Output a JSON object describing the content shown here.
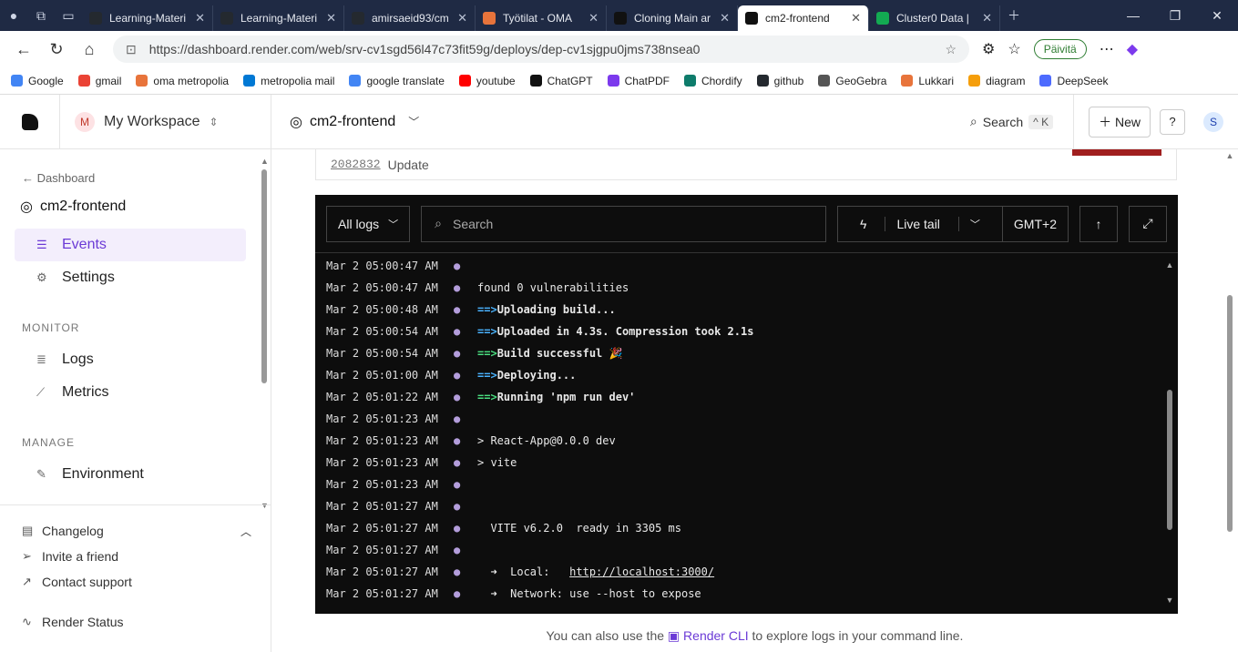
{
  "browser": {
    "tabs": [
      {
        "label": "Learning-Materi",
        "color": "#24292f"
      },
      {
        "label": "Learning-Materi",
        "color": "#24292f"
      },
      {
        "label": "amirsaeid93/cm",
        "color": "#24292f"
      },
      {
        "label": "Työtilat - OMA",
        "color": "#e8743b"
      },
      {
        "label": "Cloning Main ar",
        "color": "#111111"
      },
      {
        "label": "cm2-frontend",
        "color": "#111111",
        "active": true
      },
      {
        "label": "Cluster0 Data |",
        "color": "#13aa52"
      }
    ],
    "url": "https://dashboard.render.com/web/srv-cv1sgd56l47c73fit59g/deploys/dep-cv1sjgpu0jms738nsea0",
    "update_label": "Päivitä",
    "bookmarks": [
      {
        "label": "Google",
        "color": "#4285f4"
      },
      {
        "label": "gmail",
        "color": "#ea4335"
      },
      {
        "label": "oma metropolia",
        "color": "#e8743b"
      },
      {
        "label": "metropolia mail",
        "color": "#0078d4"
      },
      {
        "label": "google translate",
        "color": "#4285f4"
      },
      {
        "label": "youtube",
        "color": "#ff0000"
      },
      {
        "label": "ChatGPT",
        "color": "#111111"
      },
      {
        "label": "ChatPDF",
        "color": "#7c3aed"
      },
      {
        "label": "Chordify",
        "color": "#0e7c6b"
      },
      {
        "label": "github",
        "color": "#24292f"
      },
      {
        "label": "GeoGebra",
        "color": "#555555"
      },
      {
        "label": "Lukkari",
        "color": "#e8743b"
      },
      {
        "label": "diagram",
        "color": "#f59e0b"
      },
      {
        "label": "DeepSeek",
        "color": "#4d6bfe"
      }
    ]
  },
  "sidebar": {
    "workspace_initial": "M",
    "workspace": "My Workspace",
    "back_label": "Dashboard",
    "service": "cm2-frontend",
    "items": [
      {
        "label": "Events",
        "icon": "list-icon"
      },
      {
        "label": "Settings",
        "icon": "gear-icon"
      }
    ],
    "monitor_title": "MONITOR",
    "monitor_items": [
      {
        "label": "Logs",
        "icon": "logs-icon"
      },
      {
        "label": "Metrics",
        "icon": "chart-icon"
      }
    ],
    "manage_title": "MANAGE",
    "manage_items": [
      {
        "label": "Environment",
        "icon": "edit-icon"
      }
    ],
    "bottom": {
      "changelog": "Changelog",
      "invite": "Invite a friend",
      "support": "Contact support",
      "status": "Render Status"
    }
  },
  "topbar": {
    "service": "cm2-frontend",
    "search": "Search",
    "shortcut": "^ K",
    "new_label": "New",
    "user_initial": "S"
  },
  "deploy_card": {
    "commit": "2082832",
    "message": "Update"
  },
  "logs": {
    "filter": "All logs",
    "search_placeholder": "Search",
    "live_tail": "Live tail",
    "timezone": "GMT+2",
    "lines": [
      {
        "ts": "Mar 2 05:00:47 AM",
        "msg": ""
      },
      {
        "ts": "Mar 2 05:00:47 AM",
        "msg": "found 0 vulnerabilities"
      },
      {
        "ts": "Mar 2 05:00:48 AM",
        "arrow": "==>",
        "arrow_color": "blue",
        "msg": "Uploading build..."
      },
      {
        "ts": "Mar 2 05:00:54 AM",
        "arrow": "==>",
        "arrow_color": "blue",
        "msg": "Uploaded in 4.3s. Compression took 2.1s"
      },
      {
        "ts": "Mar 2 05:00:54 AM",
        "arrow": "==>",
        "arrow_color": "green",
        "msg": "Build successful 🎉"
      },
      {
        "ts": "Mar 2 05:01:00 AM",
        "arrow": "==>",
        "arrow_color": "blue",
        "msg": "Deploying..."
      },
      {
        "ts": "Mar 2 05:01:22 AM",
        "arrow": "==>",
        "arrow_color": "green",
        "msg": "Running 'npm run dev'"
      },
      {
        "ts": "Mar 2 05:01:23 AM",
        "msg": ""
      },
      {
        "ts": "Mar 2 05:01:23 AM",
        "msg": "> React-App@0.0.0 dev"
      },
      {
        "ts": "Mar 2 05:01:23 AM",
        "msg": "> vite"
      },
      {
        "ts": "Mar 2 05:01:23 AM",
        "msg": ""
      },
      {
        "ts": "Mar 2 05:01:27 AM",
        "msg": ""
      },
      {
        "ts": "Mar 2 05:01:27 AM",
        "msg": "  VITE v6.2.0  ready in 3305 ms"
      },
      {
        "ts": "Mar 2 05:01:27 AM",
        "msg": ""
      },
      {
        "ts": "Mar 2 05:01:27 AM",
        "msg": "  ➜  Local:   ",
        "link": "http://localhost:3000/"
      },
      {
        "ts": "Mar 2 05:01:27 AM",
        "msg": "  ➜  Network: use --host to expose"
      }
    ]
  },
  "footnote": {
    "before": "You can also use the",
    "cli": "Render CLI",
    "after": "to explore logs in your command line."
  }
}
